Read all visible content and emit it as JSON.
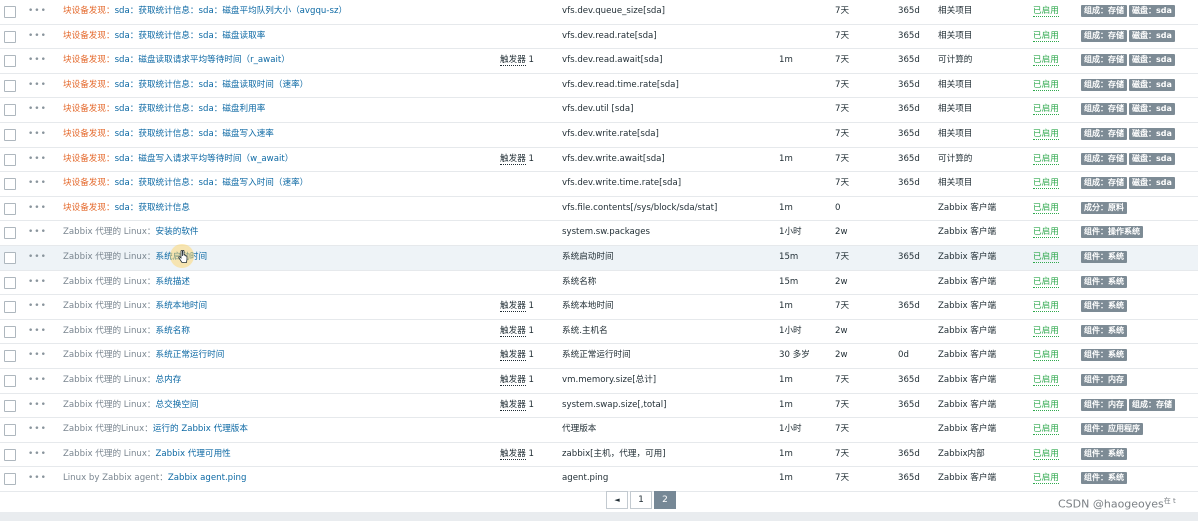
{
  "items": [
    {
      "prefix": "块设备发现：",
      "prefix_kind": "disc",
      "name": "sda：获取统计信息：sda：磁盘平均队列大小（avgqu-sz）",
      "triggers": "",
      "trigger_count": "",
      "key": "vfs.dev.queue_size[sda]",
      "interval": "",
      "history": "7天",
      "trends": "365d",
      "type": "相关项目",
      "status": "已启用",
      "tags": [
        "组成：存储",
        "磁盘：sda"
      ]
    },
    {
      "prefix": "块设备发现：",
      "prefix_kind": "disc",
      "name": "sda：获取统计信息：sda：磁盘读取率",
      "triggers": "",
      "trigger_count": "",
      "key": "vfs.dev.read.rate[sda]",
      "interval": "",
      "history": "7天",
      "trends": "365d",
      "type": "相关项目",
      "status": "已启用",
      "tags": [
        "组成：存储",
        "磁盘：sda"
      ]
    },
    {
      "prefix": "块设备发现：",
      "prefix_kind": "disc",
      "name": "sda：磁盘读取请求平均等待时间（r_await）",
      "triggers": "触发器",
      "trigger_count": "1",
      "key": "vfs.dev.read.await[sda]",
      "interval": "1m",
      "history": "7天",
      "trends": "365d",
      "type": "可计算的",
      "status": "已启用",
      "tags": [
        "组成：存储",
        "磁盘：sda"
      ]
    },
    {
      "prefix": "块设备发现：",
      "prefix_kind": "disc",
      "name": "sda：获取统计信息：sda：磁盘读取时间（速率）",
      "triggers": "",
      "trigger_count": "",
      "key": "vfs.dev.read.time.rate[sda]",
      "interval": "",
      "history": "7天",
      "trends": "365d",
      "type": "相关项目",
      "status": "已启用",
      "tags": [
        "组成：存储",
        "磁盘：sda"
      ]
    },
    {
      "prefix": "块设备发现：",
      "prefix_kind": "disc",
      "name": "sda：获取统计信息：sda：磁盘利用率",
      "triggers": "",
      "trigger_count": "",
      "key": "vfs.dev.util [sda]",
      "interval": "",
      "history": "7天",
      "trends": "365d",
      "type": "相关项目",
      "status": "已启用",
      "tags": [
        "组成：存储",
        "磁盘：sda"
      ]
    },
    {
      "prefix": "块设备发现：",
      "prefix_kind": "disc",
      "name": "sda：获取统计信息：sda：磁盘写入速率",
      "triggers": "",
      "trigger_count": "",
      "key": "vfs.dev.write.rate[sda]",
      "interval": "",
      "history": "7天",
      "trends": "365d",
      "type": "相关项目",
      "status": "已启用",
      "tags": [
        "组成：存储",
        "磁盘：sda"
      ]
    },
    {
      "prefix": "块设备发现：",
      "prefix_kind": "disc",
      "name": "sda：磁盘写入请求平均等待时间（w_await）",
      "triggers": "触发器",
      "trigger_count": "1",
      "key": "vfs.dev.write.await[sda]",
      "interval": "1m",
      "history": "7天",
      "trends": "365d",
      "type": "可计算的",
      "status": "已启用",
      "tags": [
        "组成：存储",
        "磁盘：sda"
      ]
    },
    {
      "prefix": "块设备发现：",
      "prefix_kind": "disc",
      "name": "sda：获取统计信息：sda：磁盘写入时间（速率）",
      "triggers": "",
      "trigger_count": "",
      "key": "vfs.dev.write.time.rate[sda]",
      "interval": "",
      "history": "7天",
      "trends": "365d",
      "type": "相关项目",
      "status": "已启用",
      "tags": [
        "组成：存储",
        "磁盘：sda"
      ]
    },
    {
      "prefix": "块设备发现：",
      "prefix_kind": "disc",
      "name": "sda：获取统计信息",
      "triggers": "",
      "trigger_count": "",
      "key": "vfs.file.contents[/sys/block/sda/stat]",
      "interval": "1m",
      "history": "0",
      "trends": "",
      "type": "Zabbix 客户端",
      "status": "已启用",
      "tags": [
        "成分：原料"
      ]
    },
    {
      "prefix": "Zabbix 代理的 Linux：",
      "prefix_kind": "tmpl",
      "name": "安装的软件",
      "triggers": "",
      "trigger_count": "",
      "key": "system.sw.packages",
      "interval": "1小时",
      "history": "2w",
      "trends": "",
      "type": "Zabbix 客户端",
      "status": "已启用",
      "tags": [
        "组件：操作系统"
      ]
    },
    {
      "prefix": "Zabbix 代理的 Linux：",
      "prefix_kind": "tmpl",
      "name": "系统启动时间",
      "triggers": "",
      "trigger_count": "",
      "key": "系统启动时间",
      "interval": "15m",
      "history": "7天",
      "trends": "365d",
      "type": "Zabbix 客户端",
      "status": "已启用",
      "tags": [
        "组件：系统"
      ]
    },
    {
      "prefix": "Zabbix 代理的 Linux：",
      "prefix_kind": "tmpl",
      "name": "系统描述",
      "triggers": "",
      "trigger_count": "",
      "key": "系统名称",
      "interval": "15m",
      "history": "2w",
      "trends": "",
      "type": "Zabbix 客户端",
      "status": "已启用",
      "tags": [
        "组件：系统"
      ]
    },
    {
      "prefix": "Zabbix 代理的 Linux：",
      "prefix_kind": "tmpl",
      "name": "系统本地时间",
      "triggers": "触发器",
      "trigger_count": "1",
      "key": "系统本地时间",
      "interval": "1m",
      "history": "7天",
      "trends": "365d",
      "type": "Zabbix 客户端",
      "status": "已启用",
      "tags": [
        "组件：系统"
      ]
    },
    {
      "prefix": "Zabbix 代理的 Linux：",
      "prefix_kind": "tmpl",
      "name": "系统名称",
      "triggers": "触发器",
      "trigger_count": "1",
      "key": "系统.主机名",
      "interval": "1小时",
      "history": "2w",
      "trends": "",
      "type": "Zabbix 客户端",
      "status": "已启用",
      "tags": [
        "组件：系统"
      ]
    },
    {
      "prefix": "Zabbix 代理的 Linux：",
      "prefix_kind": "tmpl",
      "name": "系统正常运行时间",
      "triggers": "触发器",
      "trigger_count": "1",
      "key": "系统正常运行时间",
      "interval": "30 多岁",
      "history": "2w",
      "trends": "0d",
      "type": "Zabbix 客户端",
      "status": "已启用",
      "tags": [
        "组件：系统"
      ]
    },
    {
      "prefix": "Zabbix 代理的 Linux：",
      "prefix_kind": "tmpl",
      "name": "总内存",
      "triggers": "触发器",
      "trigger_count": "1",
      "key": "vm.memory.size[总计]",
      "interval": "1m",
      "history": "7天",
      "trends": "365d",
      "type": "Zabbix 客户端",
      "status": "已启用",
      "tags": [
        "组件：内存"
      ]
    },
    {
      "prefix": "Zabbix 代理的 Linux：",
      "prefix_kind": "tmpl",
      "name": "总交换空间",
      "triggers": "触发器",
      "trigger_count": "1",
      "key": "system.swap.size[,total]",
      "interval": "1m",
      "history": "7天",
      "trends": "365d",
      "type": "Zabbix 客户端",
      "status": "已启用",
      "tags": [
        "组件：内存",
        "组成：存储"
      ]
    },
    {
      "prefix": "Zabbix 代理的Linux：",
      "prefix_kind": "tmpl",
      "name": "运行的 Zabbix 代理版本",
      "triggers": "",
      "trigger_count": "",
      "key": "代理版本",
      "interval": "1小时",
      "history": "7天",
      "trends": "",
      "type": "Zabbix 客户端",
      "status": "已启用",
      "tags": [
        "组件：应用程序"
      ]
    },
    {
      "prefix": "Zabbix 代理的 Linux：",
      "prefix_kind": "tmpl",
      "name": "Zabbix 代理可用性",
      "triggers": "触发器",
      "trigger_count": "1",
      "key": "zabbix[主机，代理，可用]",
      "interval": "1m",
      "history": "7天",
      "trends": "365d",
      "type": "Zabbix内部",
      "status": "已启用",
      "tags": [
        "组件：系统"
      ]
    },
    {
      "prefix": "Linux by Zabbix agent：",
      "prefix_kind": "tmpl",
      "name": "Zabbix agent.ping",
      "triggers": "",
      "trigger_count": "",
      "key": "agent.ping",
      "interval": "1m",
      "history": "7天",
      "trends": "365d",
      "type": "Zabbix 客户端",
      "status": "已启用",
      "tags": [
        "组件：系统"
      ]
    }
  ],
  "hover_row": 10,
  "pagination": {
    "prev_icon": "chevron-left-icon",
    "prev_glyph": "◄",
    "pages": [
      "1",
      "2"
    ],
    "current": "2"
  },
  "row_menu_glyph": "•••",
  "watermark": {
    "text": "CSDN @haogeoyes",
    "suffix": "在 t"
  },
  "colors": {
    "discovery_prefix": "#e4692c",
    "link": "#0d69a4",
    "enabled": "#2fa94d",
    "tag_bg": "#7d8b95",
    "page_current": "#768896"
  }
}
